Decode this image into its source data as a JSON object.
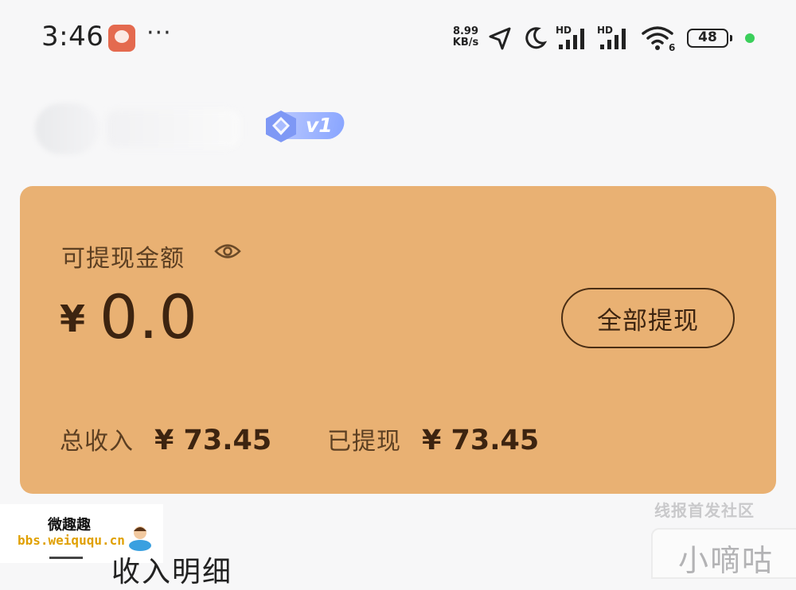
{
  "status_bar": {
    "time": "3:46",
    "app_icon": "notification-app-icon",
    "more": "···",
    "net_speed_value": "8.99",
    "net_speed_unit": "KB/s",
    "network_type_1": "HD",
    "network_type_2": "HD",
    "wifi_label": "6",
    "battery_level": "48",
    "icons": [
      "location-arrow-icon",
      "moon-icon",
      "signal-icon",
      "signal-icon",
      "wifi-icon",
      "battery-icon"
    ]
  },
  "profile": {
    "vip_level": "v1"
  },
  "wallet": {
    "balance_label": "可提现金额",
    "currency_symbol": "¥",
    "balance": "0.0",
    "withdraw_all_label": "全部提现",
    "total_income_label": "总收入",
    "total_income_value": "¥ 73.45",
    "withdrawn_label": "已提现",
    "withdrawn_value": "¥ 73.45",
    "card_color": "#e9b173"
  },
  "watermarks": {
    "right": "线报首发社区",
    "left_cn": "微趣趣",
    "left_url": "bbs.weiququ.cn",
    "brand": "小嘀咕"
  },
  "section": {
    "title": "收入明细"
  }
}
